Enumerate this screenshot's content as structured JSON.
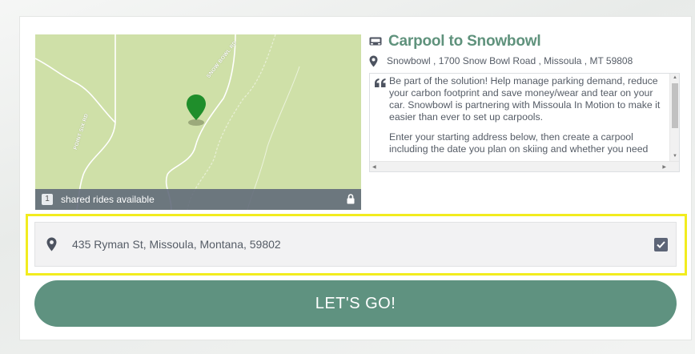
{
  "map": {
    "road_labels": [
      "SNOW BOWL RD",
      "POINT SIX RD"
    ],
    "footer": {
      "count": "1",
      "text": "shared rides available"
    }
  },
  "event": {
    "title": "Carpool to Snowbowl",
    "address": "Snowbowl , 1700 Snow Bowl Road , Missoula , MT 59808",
    "description": [
      "Be part of the solution! Help manage parking demand, reduce your carbon footprint and save money/wear and tear on your car. Snowbowl is partnering with Missoula In Motion to make it easier than ever to set up carpools.",
      "Enter your starting address below, then create a carpool including the date you plan on skiing and whether you need"
    ]
  },
  "start_address": {
    "value": "435 Ryman St, Missoula, Montana, 59802",
    "checked": true
  },
  "submit_label": "LET'S GO!",
  "colors": {
    "accent": "#5f9280",
    "pin_green": "#1f8e2b",
    "highlight": "#f2ec1e",
    "map_bg": "#cfe0a8"
  },
  "icons": [
    "bus-icon",
    "map-pin-icon",
    "quote-icon",
    "lock-icon",
    "checkmark-icon"
  ]
}
